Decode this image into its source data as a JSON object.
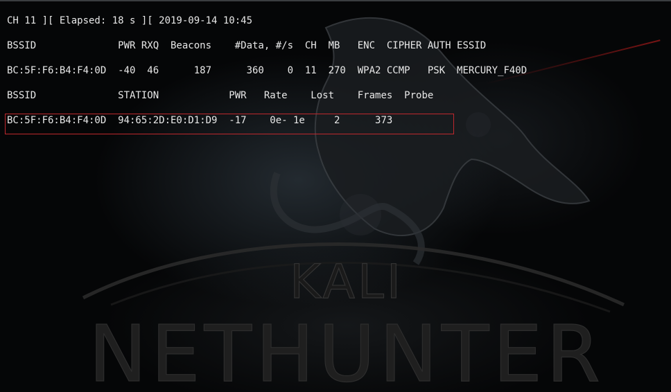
{
  "terminal": {
    "status_line": "CH 11 ][ Elapsed: 18 s ][ 2019-09-14 10:45",
    "ap_header": "BSSID              PWR RXQ  Beacons    #Data, #/s  CH  MB   ENC  CIPHER AUTH ESSID",
    "ap_row": "BC:5F:F6:B4:F4:0D  -40  46      187      360    0  11  270  WPA2 CCMP   PSK  MERCURY_F40D",
    "station_header": "BSSID              STATION            PWR   Rate    Lost    Frames  Probe",
    "station_row": "BC:5F:F6:B4:F4:0D  94:65:2D:E0:D1:D9  -17    0e- 1e     2      373"
  },
  "wallpaper": {
    "brand_top": "KALI",
    "brand_bottom": "NETHUNTER"
  },
  "colors": {
    "background": "#050607",
    "text": "#e8e8e8",
    "highlight_border": "#c0282d"
  }
}
